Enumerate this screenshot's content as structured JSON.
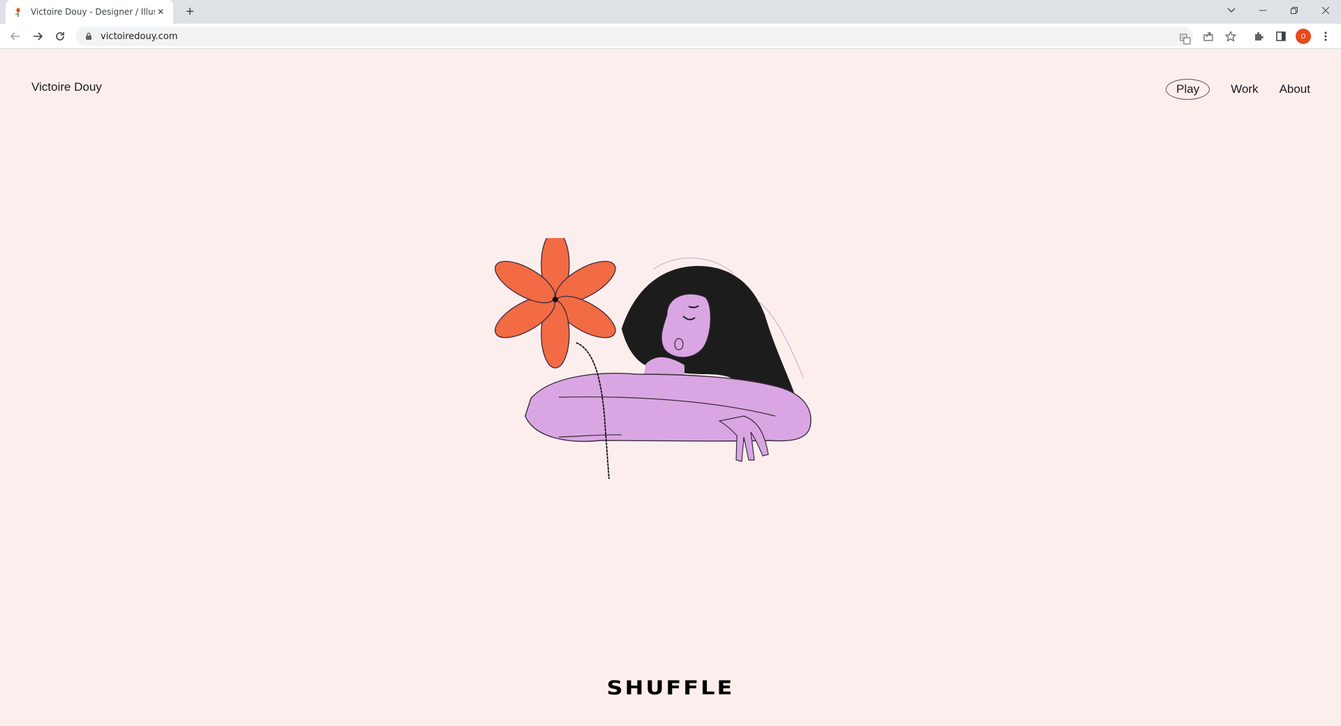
{
  "browser": {
    "tab_title": "Victoire Douy - Designer / Illustrator",
    "url": "victoiredouy.com",
    "profile_initial": "O",
    "accent": "#e8491d"
  },
  "site": {
    "name": "Victoire Douy",
    "nav": [
      {
        "label": "Play",
        "active": true
      },
      {
        "label": "Work",
        "active": false
      },
      {
        "label": "About",
        "active": false
      }
    ],
    "shuffle_label": "SHUFFLE",
    "background": "#fdeeee",
    "illustration": {
      "flower_color": "#f26b44",
      "skin_color": "#d9a6e3",
      "hair_color": "#1c1c1c"
    }
  }
}
